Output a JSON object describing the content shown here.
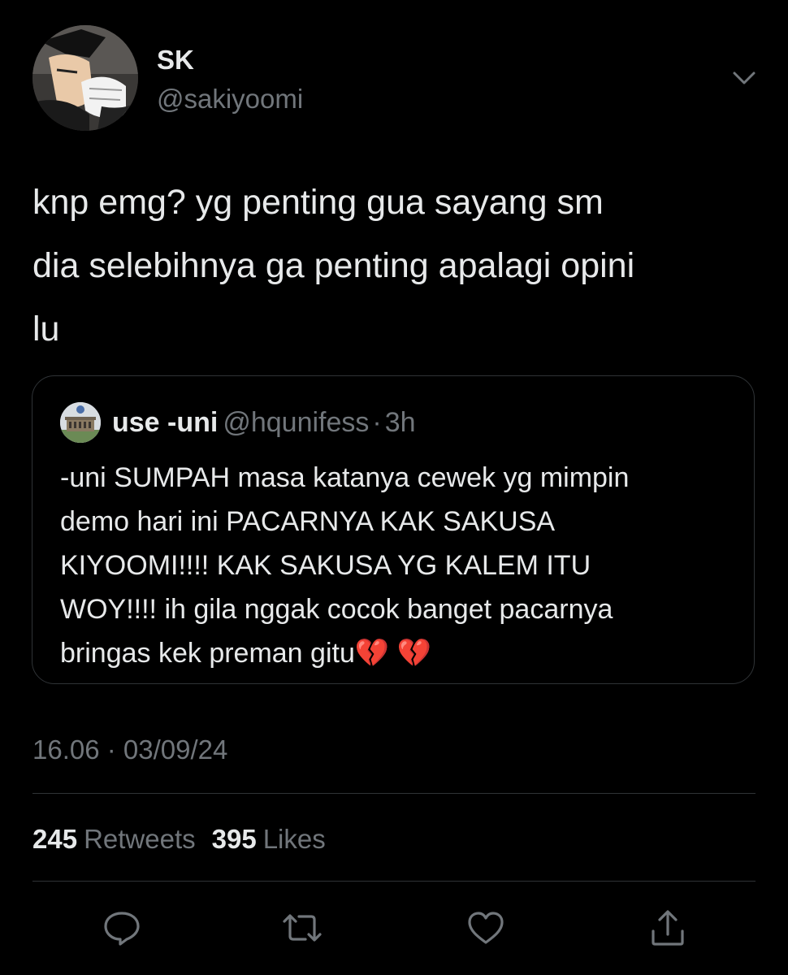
{
  "author": {
    "display_name": "SK",
    "handle": "@sakiyoomi",
    "avatar_icon": "avatar-anime-character-icon"
  },
  "tweet": {
    "text": "knp emg? yg penting gua sayang sm\ndia selebihnya ga penting apalagi opini\nlu"
  },
  "quote": {
    "display_name": "use -uni",
    "handle": "@hqunifess",
    "separator": "·",
    "time": "3h",
    "avatar_icon": "avatar-building-icon",
    "text": "-uni SUMPAH masa katanya cewek yg mimpin\ndemo hari ini PACARNYA KAK SAKUSA\nKIYOOMI!!!! KAK SAKUSA YG KALEM ITU\nWOY!!!! ih gila nggak cocok banget pacarnya\nbringas kek preman gitu💔 💔"
  },
  "meta": {
    "timestamp": "16.06 · 03/09/24"
  },
  "stats": {
    "retweets_count": "245",
    "retweets_label": "Retweets",
    "likes_count": "395",
    "likes_label": "Likes"
  },
  "actions": [
    "reply-icon",
    "retweet-icon",
    "like-icon",
    "share-icon"
  ],
  "colors": {
    "background": "#000000",
    "primary_text": "#e7e9ea",
    "secondary_text": "#71767b",
    "border": "#2f3336"
  }
}
